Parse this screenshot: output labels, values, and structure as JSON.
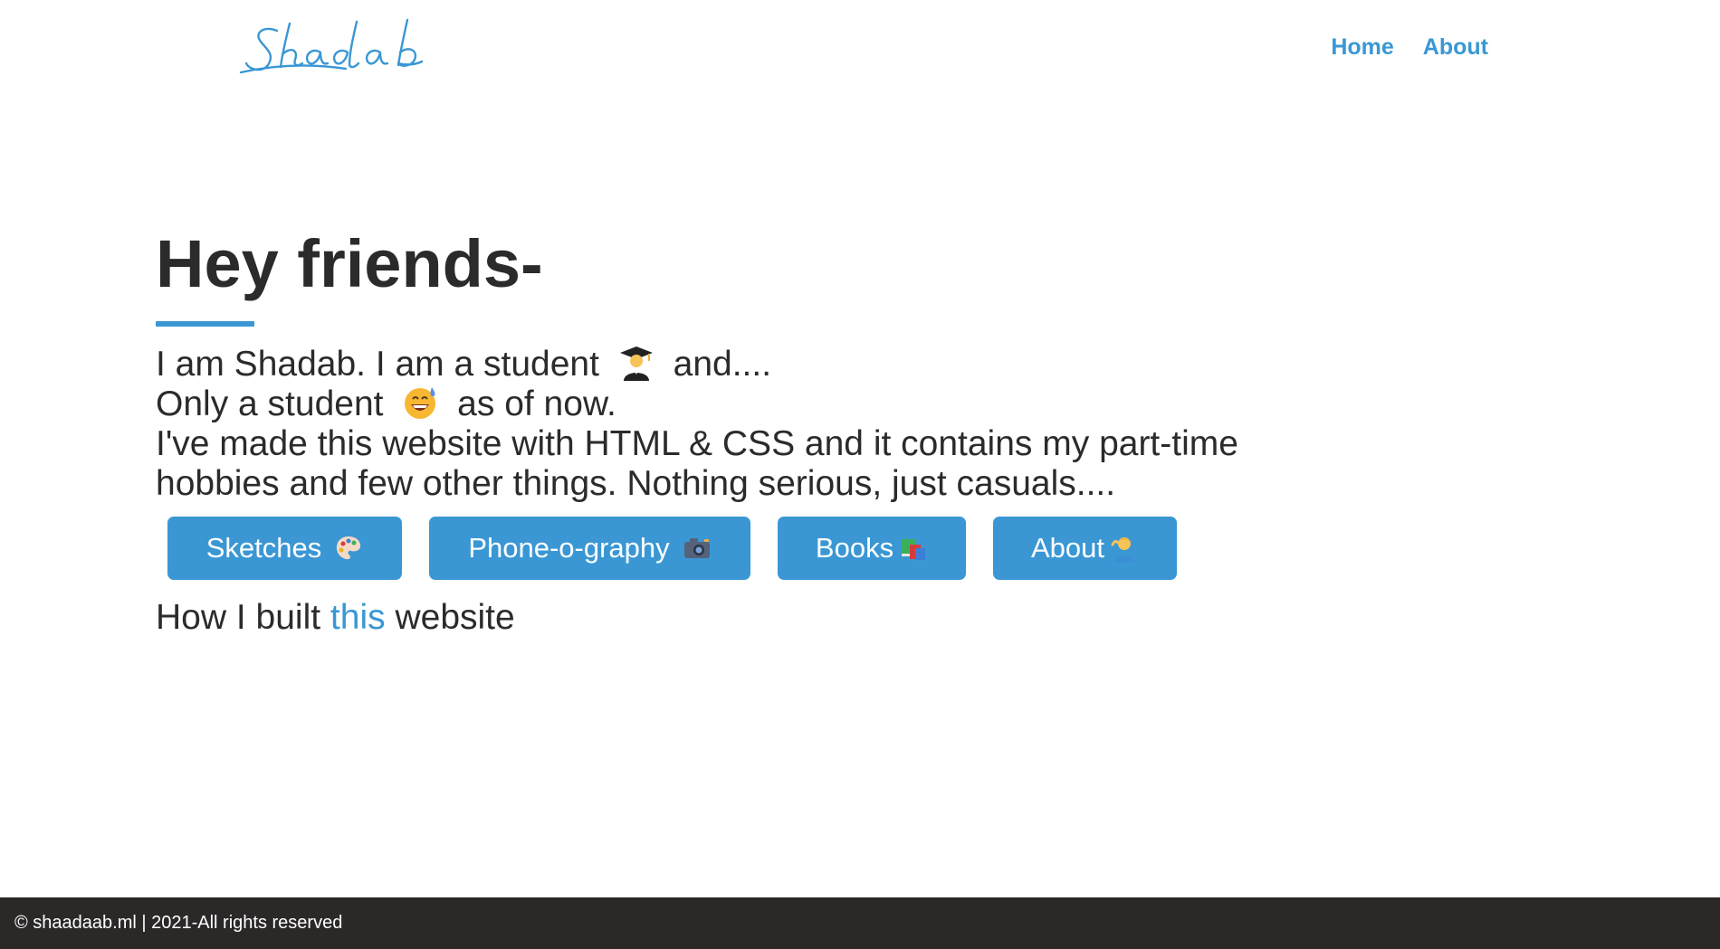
{
  "header": {
    "logo_text": "Shadab",
    "nav": [
      {
        "label": "Home"
      },
      {
        "label": "About"
      }
    ]
  },
  "main": {
    "heading": "Hey friends-",
    "intro": {
      "line1_a": "I am Shadab. I am a student",
      "line1_b": "and....",
      "line2_a": "Only a student",
      "line2_b": "as of now.",
      "line3": "I've made this website with HTML & CSS and it contains my part-time",
      "line4": "hobbies and few other things. Nothing serious, just casuals...."
    },
    "buttons": [
      {
        "label": "Sketches",
        "icon": "palette-icon"
      },
      {
        "label": "Phone-o-graphy",
        "icon": "camera-icon"
      },
      {
        "label": "Books",
        "icon": "books-icon"
      },
      {
        "label": "About",
        "icon": "person-icon"
      }
    ],
    "built": {
      "before": "How I built",
      "link": "this",
      "after": "website"
    }
  },
  "footer": {
    "text": "© shaadaab.ml | 2021-All rights reserved"
  },
  "colors": {
    "accent": "#3a97d4",
    "text": "#2b2b2b",
    "footer_bg": "#2b2828"
  }
}
